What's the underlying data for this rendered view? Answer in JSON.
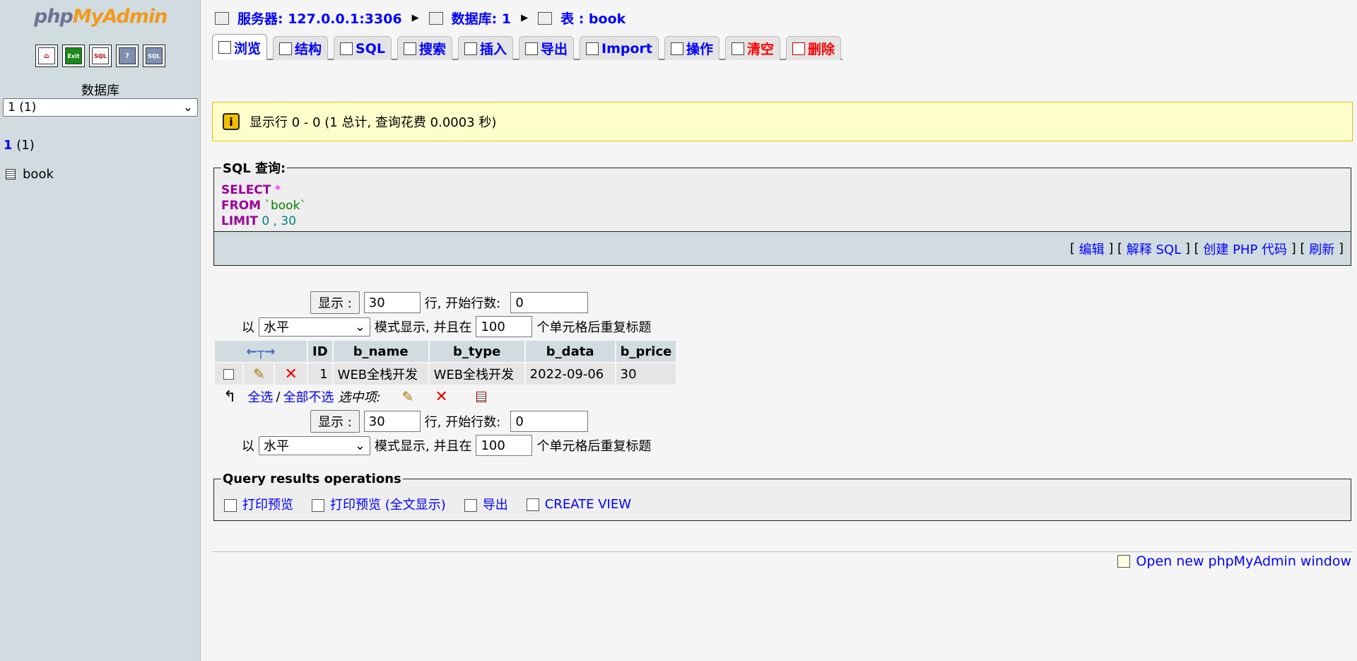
{
  "sidebar": {
    "logo_php": "php",
    "logo_myadmin": "MyAdmin",
    "nav_icons": [
      {
        "name": "home-icon",
        "label": "⌂"
      },
      {
        "name": "exit-icon",
        "label": "Exit"
      },
      {
        "name": "sql-query-icon",
        "label": "SQL"
      },
      {
        "name": "docs-icon",
        "label": "?"
      },
      {
        "name": "sql-docs-icon",
        "label": "SQL"
      }
    ],
    "db_label": "数据库",
    "db_select_value": "1 (1)",
    "current_db_name": "1",
    "current_db_count": "(1)",
    "table_name": "book"
  },
  "breadcrumb": {
    "server": "服务器: 127.0.0.1:3306",
    "database": "数据库: 1",
    "table": "表 : book"
  },
  "tabs": [
    {
      "label": "浏览",
      "active": true
    },
    {
      "label": "结构"
    },
    {
      "label": "SQL"
    },
    {
      "label": "搜索"
    },
    {
      "label": "插入"
    },
    {
      "label": "导出"
    },
    {
      "label": "Import"
    },
    {
      "label": "操作"
    },
    {
      "label": "清空",
      "red": true
    },
    {
      "label": "删除",
      "red": true
    }
  ],
  "notice": {
    "text": "显示行 0 - 0 (1 总计, 查询花费 0.0003 秒)"
  },
  "sql_box": {
    "legend": "SQL 查询:",
    "select_kw": "SELECT",
    "star": "*",
    "from_kw": "FROM",
    "table": "`book`",
    "limit_kw": "LIMIT",
    "limit_val": "0 , 30",
    "links": [
      "编辑",
      "解释 SQL",
      "创建 PHP 代码",
      "刷新"
    ]
  },
  "controls": {
    "show_button": "显示 :",
    "rows_value": "30",
    "rows_label": "行, 开始行数:",
    "start_value": "0",
    "mode_prefix": "以",
    "mode_value": "水平",
    "mode_label": "模式显示, 并且在",
    "repeat_value": "100",
    "repeat_label": "个单元格后重复标题"
  },
  "results": {
    "columns": [
      "ID",
      "b_name",
      "b_type",
      "b_data",
      "b_price"
    ],
    "rows": [
      {
        "ID": "1",
        "b_name": "WEB全栈开发",
        "b_type": "WEB全栈开发",
        "b_data": "2022-09-06",
        "b_price": "30"
      }
    ]
  },
  "selection": {
    "select_all": "全选",
    "unselect_all": "全部不选",
    "with_selected": "选中项:"
  },
  "ops_box": {
    "legend": "Query results operations",
    "links": [
      "打印预览",
      "打印预览 (全文显示)",
      "导出",
      "CREATE VIEW"
    ]
  },
  "footer": {
    "new_window": "Open new phpMyAdmin window"
  },
  "colors": {
    "link": "#0000ff",
    "sidebar_bg": "#d0dce0",
    "notice_bg": "#ffffcc",
    "sql_keyword": "#990099"
  }
}
